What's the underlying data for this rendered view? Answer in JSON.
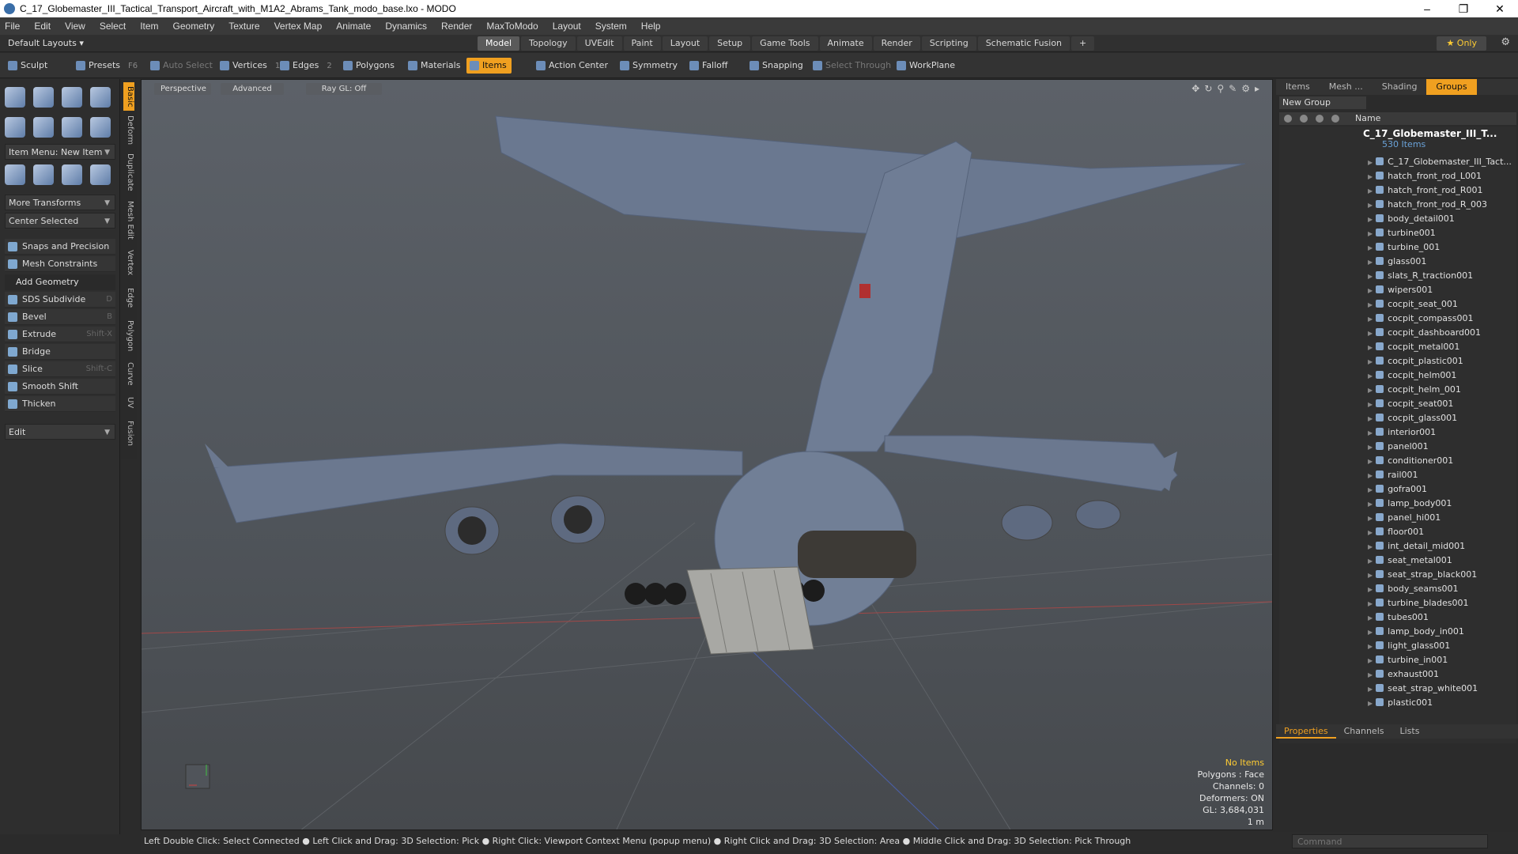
{
  "window": {
    "title": "C_17_Globemaster_III_Tactical_Transport_Aircraft_with_M1A2_Abrams_Tank_modo_base.lxo - MODO"
  },
  "menu": [
    "File",
    "Edit",
    "View",
    "Select",
    "Item",
    "Geometry",
    "Texture",
    "Vertex Map",
    "Animate",
    "Dynamics",
    "Render",
    "MaxToModo",
    "Layout",
    "System",
    "Help"
  ],
  "layout": {
    "current": "Default Layouts",
    "only": "Only"
  },
  "tabs": [
    "Model",
    "Topology",
    "UVEdit",
    "Paint",
    "Layout",
    "Setup",
    "Game Tools",
    "Animate",
    "Render",
    "Scripting",
    "Schematic Fusion"
  ],
  "toolbar": {
    "sculpt": "Sculpt",
    "presets": "Presets",
    "presets_key": "F6",
    "auto_select": "Auto Select",
    "vertices": "Vertices",
    "vertices_n": "1",
    "edges": "Edges",
    "edges_n": "2",
    "polygons": "Polygons",
    "materials": "Materials",
    "items": "Items",
    "action_center": "Action Center",
    "symmetry": "Symmetry",
    "falloff": "Falloff",
    "snapping": "Snapping",
    "select_through": "Select Through",
    "workplane": "WorkPlane"
  },
  "left": {
    "item_menu": "Item Menu: New Item",
    "more_transforms": "More Transforms",
    "center_selected": "Center Selected",
    "snaps": "Snaps and Precision",
    "mesh_constraints": "Mesh Constraints",
    "add_geometry": "Add Geometry",
    "tools": [
      {
        "label": "SDS Subdivide",
        "key": "D"
      },
      {
        "label": "Bevel",
        "key": "B"
      },
      {
        "label": "Extrude",
        "key": "Shift-X"
      },
      {
        "label": "Bridge",
        "key": ""
      },
      {
        "label": "Slice",
        "key": "Shift-C"
      },
      {
        "label": "Smooth Shift",
        "key": ""
      },
      {
        "label": "Thicken",
        "key": ""
      }
    ],
    "edit": "Edit"
  },
  "vtabs": [
    "Basic",
    "Deform",
    "Duplicate",
    "Mesh Edit",
    "Vertex",
    "Edge",
    "Polygon",
    "Curve",
    "UV",
    "Fusion"
  ],
  "viewport": {
    "view": "Perspective",
    "advanced": "Advanced",
    "raygl": "Ray GL: Off",
    "info": {
      "items": "No Items",
      "polygons": "Polygons : Face",
      "channels": "Channels: 0",
      "deformers": "Deformers: ON",
      "gl": "GL: 3,684,031",
      "scale": "1 m"
    }
  },
  "right": {
    "tabs": [
      "Items",
      "Mesh ...",
      "Shading",
      "Groups"
    ],
    "new_group": "New Group",
    "name_col": "Name",
    "root": "C_17_Globemaster_III_T...",
    "root_count": "530 Items",
    "items": [
      "C_17_Globemaster_III_Tact...",
      "hatch_front_rod_L001",
      "hatch_front_rod_R001",
      "hatch_front_rod_R_003",
      "body_detail001",
      "turbine001",
      "turbine_001",
      "glass001",
      "slats_R_traction001",
      "wipers001",
      "cocpit_seat_001",
      "cocpit_compass001",
      "cocpit_dashboard001",
      "cocpit_metal001",
      "cocpit_plastic001",
      "cocpit_helm001",
      "cocpit_helm_001",
      "cocpit_seat001",
      "cocpit_glass001",
      "interior001",
      "panel001",
      "conditioner001",
      "rail001",
      "gofra001",
      "lamp_body001",
      "panel_hi001",
      "floor001",
      "int_detail_mid001",
      "seat_metal001",
      "seat_strap_black001",
      "body_seams001",
      "turbine_blades001",
      "tubes001",
      "lamp_body_in001",
      "light_glass001",
      "turbine_in001",
      "exhaust001",
      "seat_strap_white001",
      "plastic001"
    ],
    "bottom_tabs": [
      "Properties",
      "Channels",
      "Lists"
    ]
  },
  "status": "Left Double Click: Select Connected ● Left Click and Drag: 3D Selection: Pick ● Right Click: Viewport Context Menu (popup menu) ● Right Click and Drag: 3D Selection: Area ● Middle Click and Drag: 3D Selection: Pick Through",
  "command_placeholder": "Command"
}
